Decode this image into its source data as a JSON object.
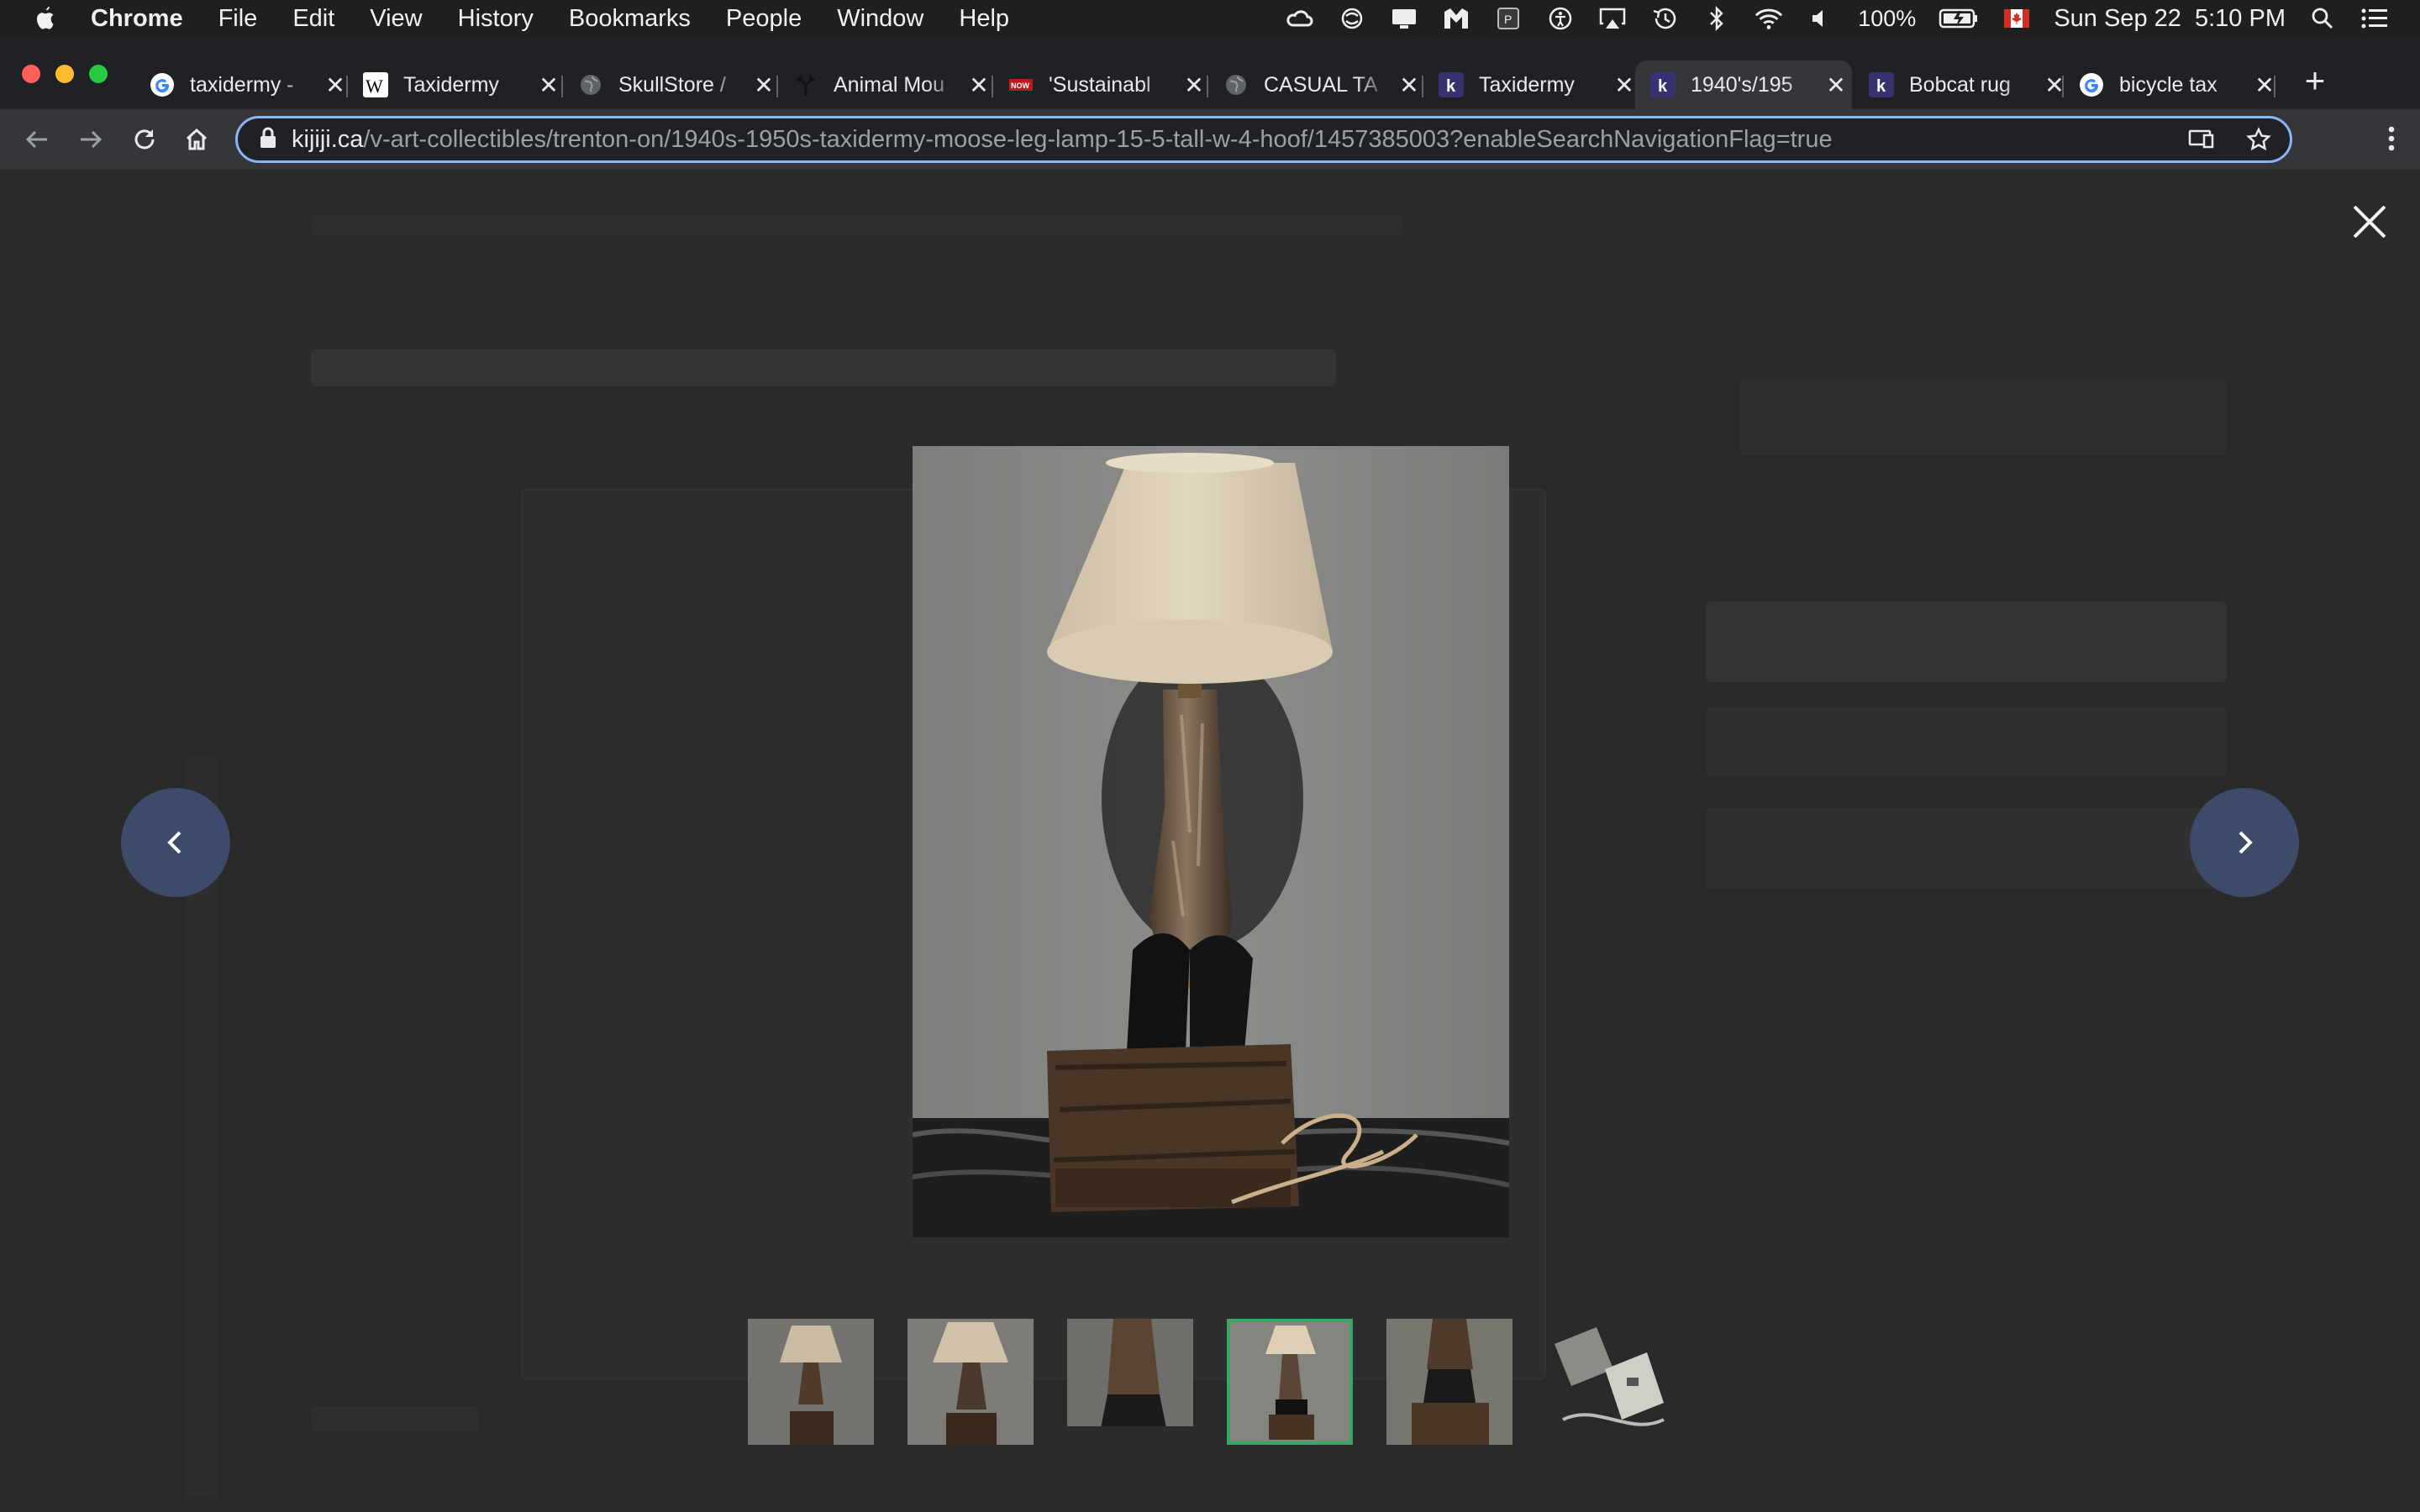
{
  "menubar": {
    "app": "Chrome",
    "items": [
      "File",
      "Edit",
      "View",
      "History",
      "Bookmarks",
      "People",
      "Window",
      "Help"
    ],
    "battery": "100%",
    "datetime": "Sun Sep 22  5:10 PM"
  },
  "tabs": [
    {
      "title": "taxidermy -",
      "favicon": "google-icon"
    },
    {
      "title": "Taxidermy",
      "favicon": "wikipedia-icon"
    },
    {
      "title": "SkullStore /",
      "favicon": "globe-icon"
    },
    {
      "title": "Animal Mou",
      "favicon": "antler-icon"
    },
    {
      "title": "'Sustainabl",
      "favicon": "now-icon"
    },
    {
      "title": "CASUAL TA",
      "favicon": "globe-icon"
    },
    {
      "title": "Taxidermy",
      "favicon": "kijiji-icon"
    },
    {
      "title": "1940's/195",
      "favicon": "kijiji-icon",
      "active": true
    },
    {
      "title": "Bobcat rug",
      "favicon": "kijiji-icon"
    },
    {
      "title": "bicycle tax",
      "favicon": "google-icon"
    }
  ],
  "address": {
    "host": "kijiji.ca",
    "path": "/v-art-collectibles/trenton-on/1940s-1950s-taxidermy-moose-leg-lamp-15-5-tall-w-4-hoof/1457385003?enableSearchNavigationFlag=true"
  },
  "gallery": {
    "photo_count": 6,
    "selected_index": 3
  }
}
